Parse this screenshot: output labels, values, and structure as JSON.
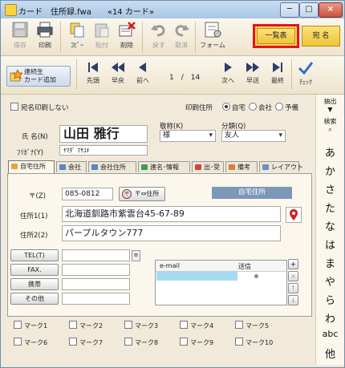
{
  "window": {
    "title": "カード　住所録.fwa　　«14 カード»",
    "btn_min": "─",
    "btn_max": "□",
    "btn_close": "×"
  },
  "toolbar": {
    "save": "保存",
    "print": "印刷",
    "copy": "ｺﾋﾟｰ",
    "paste": "貼付",
    "delete": "削除",
    "undo": "戻す",
    "cancel": "取消",
    "form": "フォーム",
    "list": "一覧表",
    "address": "宛 名"
  },
  "nav": {
    "add_card": "連続生\nカード追加",
    "first": "先頭",
    "fast_back": "早戻",
    "prev": "前へ",
    "record": "1　/　14",
    "next": "次へ",
    "fast_forward": "早送",
    "last": "最終",
    "check": "ﾁｪｯｸ"
  },
  "form": {
    "no_print_label": "宛名印刷しない",
    "print_addr_label": "印刷住所",
    "radio_home": "自宅",
    "radio_company": "会社",
    "radio_spare": "予備",
    "name_label": "氏 名(N)",
    "name_value": "山田 雅行",
    "furigana_label": "ﾌﾘｶﾞﾅ(Y)",
    "furigana_value": "ﾔﾏﾀﾞ ﾏｻﾕｷ",
    "honorific_label": "敬称(K)",
    "honorific_value": "様",
    "category_label": "分類(Q)",
    "category_value": "友人"
  },
  "tabs": [
    "自宅住所",
    "会社",
    "会社住所",
    "連名･情報",
    "出･受",
    "備考",
    "レイアウト"
  ],
  "panel": {
    "zip_label": "〒(Z)",
    "zip_value": "085-0812",
    "zip_button": "〒⇔住所",
    "home_badge": "自宅住所",
    "addr1_label": "住所1(1)",
    "addr1_value": "北海道釧路市紫雲台45-67-89",
    "addr2_label": "住所2(2)",
    "addr2_value": "パープルタウン777",
    "tel_label": "TEL(T)",
    "fax_label": "FAX.",
    "mobile_label": "携帯",
    "other_label": "その他",
    "grid_col1": "e-mail",
    "grid_col2": "送信",
    "btn_plus": "+",
    "btn_x": "×",
    "btn_up": "↑",
    "btn_down": "↓"
  },
  "marks": [
    "マーク1",
    "マーク2",
    "マーク3",
    "マーク4",
    "マーク5",
    "マーク6",
    "マーク7",
    "マーク8",
    "マーク9",
    "マーク10"
  ],
  "side": {
    "extract": "抽出",
    "search": "検索",
    "kana": [
      "あ",
      "か",
      "さ",
      "た",
      "な",
      "は",
      "ま",
      "や",
      "ら",
      "わ",
      "abc",
      "他"
    ]
  }
}
